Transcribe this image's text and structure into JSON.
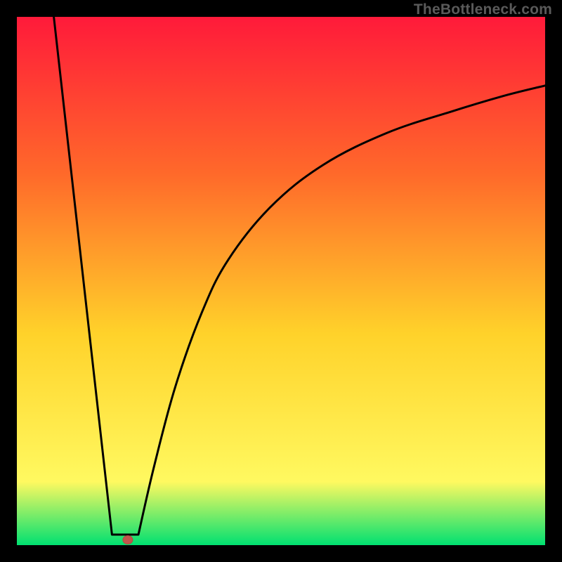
{
  "watermark": "TheBottleneck.com",
  "colors": {
    "bg_black": "#000000",
    "grad_top": "#ff1a3a",
    "grad_mid_top": "#ff6a2a",
    "grad_mid": "#ffd22a",
    "grad_mid_bot": "#fff960",
    "grad_bot": "#00e071",
    "curve": "#000000",
    "marker_fill": "#c0564c",
    "marker_stroke": "#b24a40",
    "watermark": "#5a5a5a"
  },
  "chart_data": {
    "type": "line",
    "title": "",
    "xlabel": "",
    "ylabel": "",
    "xlim": [
      0,
      100
    ],
    "ylim": [
      0,
      100
    ],
    "marker": {
      "x": 21,
      "y": 1
    },
    "left_branch": [
      {
        "x": 7,
        "y": 100
      },
      {
        "x": 18,
        "y": 2
      },
      {
        "x": 23,
        "y": 2
      }
    ],
    "right_branch": [
      {
        "x": 23,
        "y": 2
      },
      {
        "x": 26,
        "y": 15
      },
      {
        "x": 30,
        "y": 30
      },
      {
        "x": 35,
        "y": 44
      },
      {
        "x": 40,
        "y": 54
      },
      {
        "x": 48,
        "y": 64
      },
      {
        "x": 58,
        "y": 72
      },
      {
        "x": 70,
        "y": 78
      },
      {
        "x": 82,
        "y": 82
      },
      {
        "x": 92,
        "y": 85
      },
      {
        "x": 100,
        "y": 87
      }
    ]
  }
}
